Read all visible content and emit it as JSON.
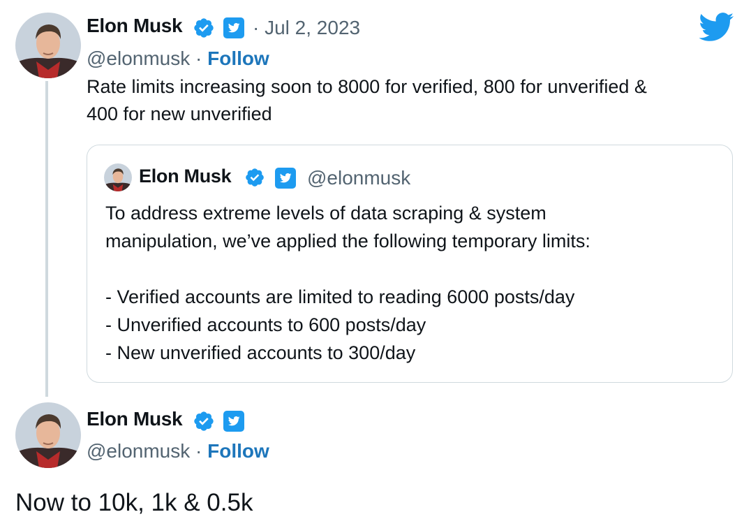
{
  "tweet1": {
    "name": "Elon Musk",
    "date": "· Jul 2, 2023",
    "handle": "@elonmusk",
    "separator": "·",
    "follow_label": "Follow",
    "text_line1": "Rate limits increasing soon to 8000 for verified, 800 for unverified &",
    "text_line2": "400 for new unverified"
  },
  "quoted_tweet": {
    "name": "Elon Musk",
    "handle": "@elonmusk",
    "lines": [
      "To address extreme levels of data scraping & system",
      "manipulation, we’ve applied the following temporary limits:",
      "",
      "- Verified accounts are limited to reading 6000 posts/day",
      "- Unverified accounts to 600 posts/day",
      "- New unverified accounts to 300/day"
    ]
  },
  "tweet2": {
    "name": "Elon Musk",
    "handle": "@elonmusk",
    "separator": "·",
    "follow_label": "Follow",
    "text": "Now to 10k, 1k & 0.5k"
  },
  "icons": {
    "verified_badge": "verified-badge-icon",
    "square_badge": "twitter-square-icon",
    "logo": "twitter-bird-icon"
  },
  "colors": {
    "brand_blue": "#1d9bf0",
    "follow_blue": "#1d76bb",
    "muted_text": "#536471",
    "border": "#cfd9de"
  }
}
